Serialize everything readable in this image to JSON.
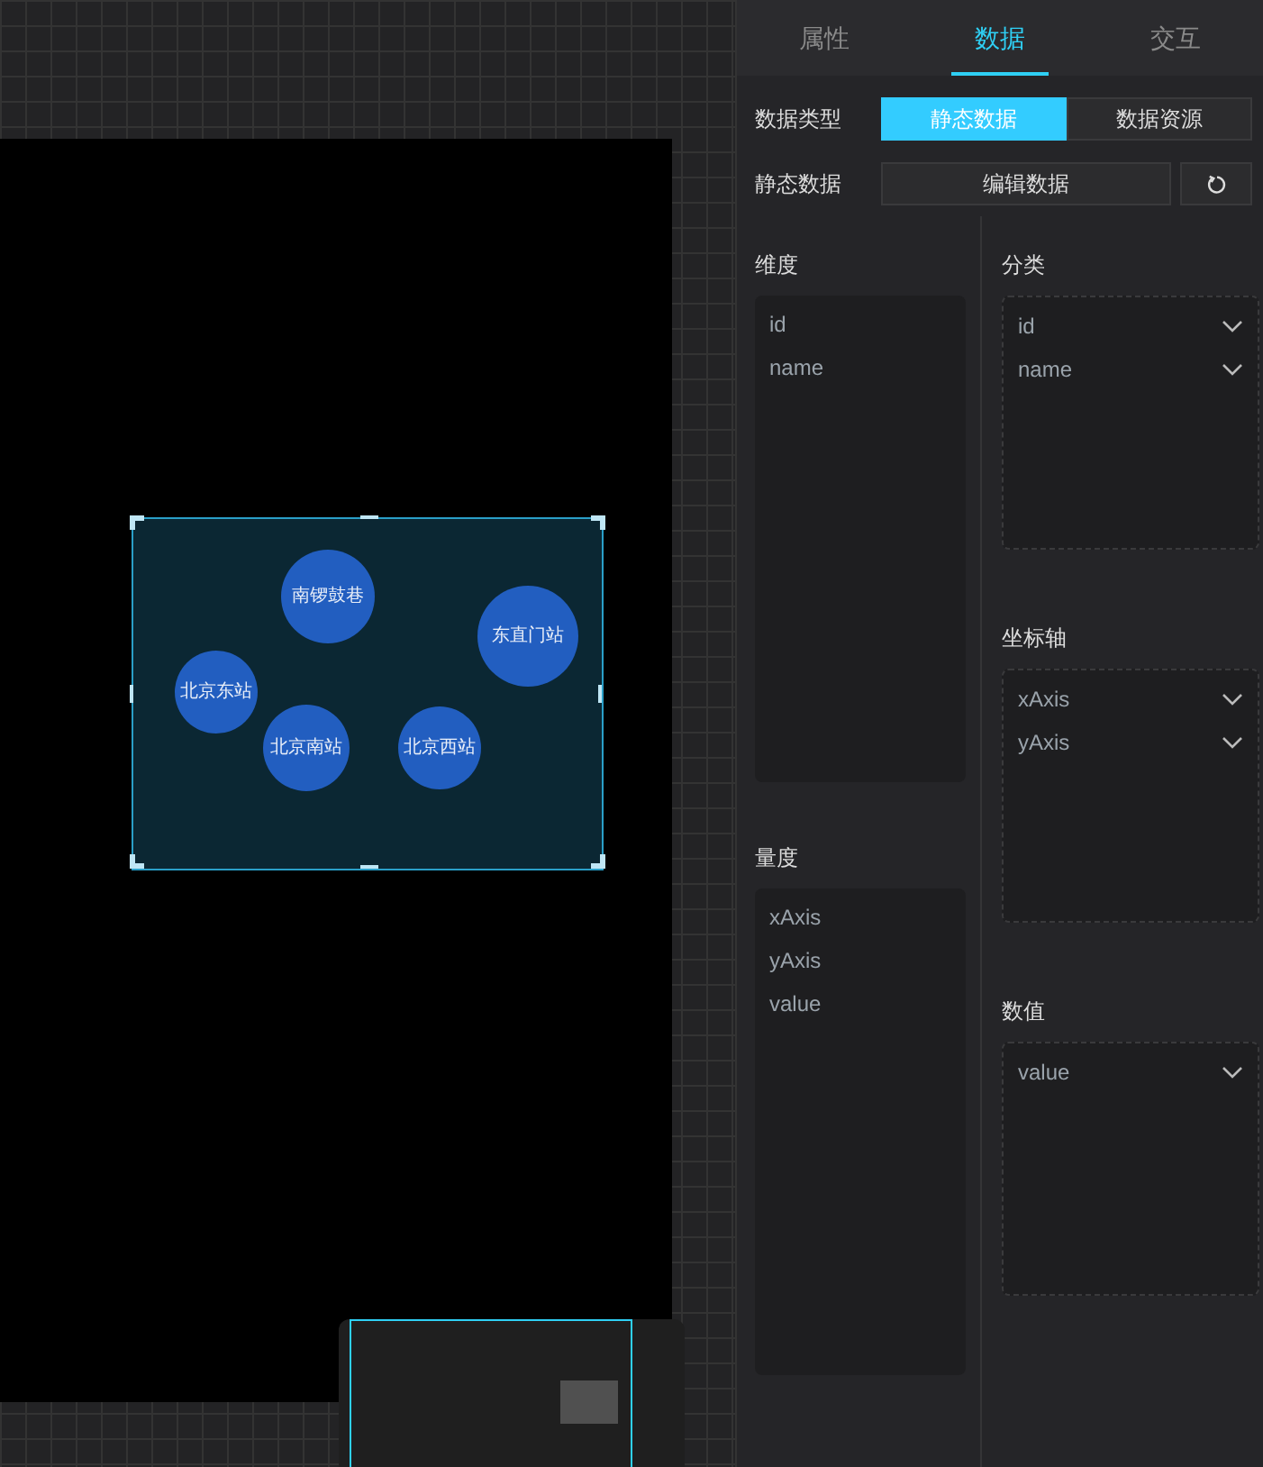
{
  "canvas": {
    "chart": {
      "bubbles": [
        {
          "label": "南锣鼓巷"
        },
        {
          "label": "东直门站"
        },
        {
          "label": "北京东站"
        },
        {
          "label": "北京南站"
        },
        {
          "label": "北京西站"
        }
      ]
    }
  },
  "panel": {
    "tabs": [
      {
        "label": "属性",
        "selected": false
      },
      {
        "label": "数据",
        "selected": true
      },
      {
        "label": "交互",
        "selected": false
      }
    ],
    "data_type": {
      "label": "数据类型",
      "options": [
        {
          "label": "静态数据",
          "selected": true
        },
        {
          "label": "数据资源",
          "selected": false
        }
      ]
    },
    "static_data": {
      "label": "静态数据",
      "button": "编辑数据"
    },
    "dimensions": {
      "title": "维度",
      "items": [
        "id",
        "name"
      ]
    },
    "measures": {
      "title": "量度",
      "items": [
        "xAxis",
        "yAxis",
        "value"
      ]
    },
    "slots": [
      {
        "title": "分类",
        "items": [
          "id",
          "name"
        ]
      },
      {
        "title": "坐标轴",
        "items": [
          "xAxis",
          "yAxis"
        ]
      },
      {
        "title": "数值",
        "items": [
          "value"
        ]
      }
    ]
  }
}
